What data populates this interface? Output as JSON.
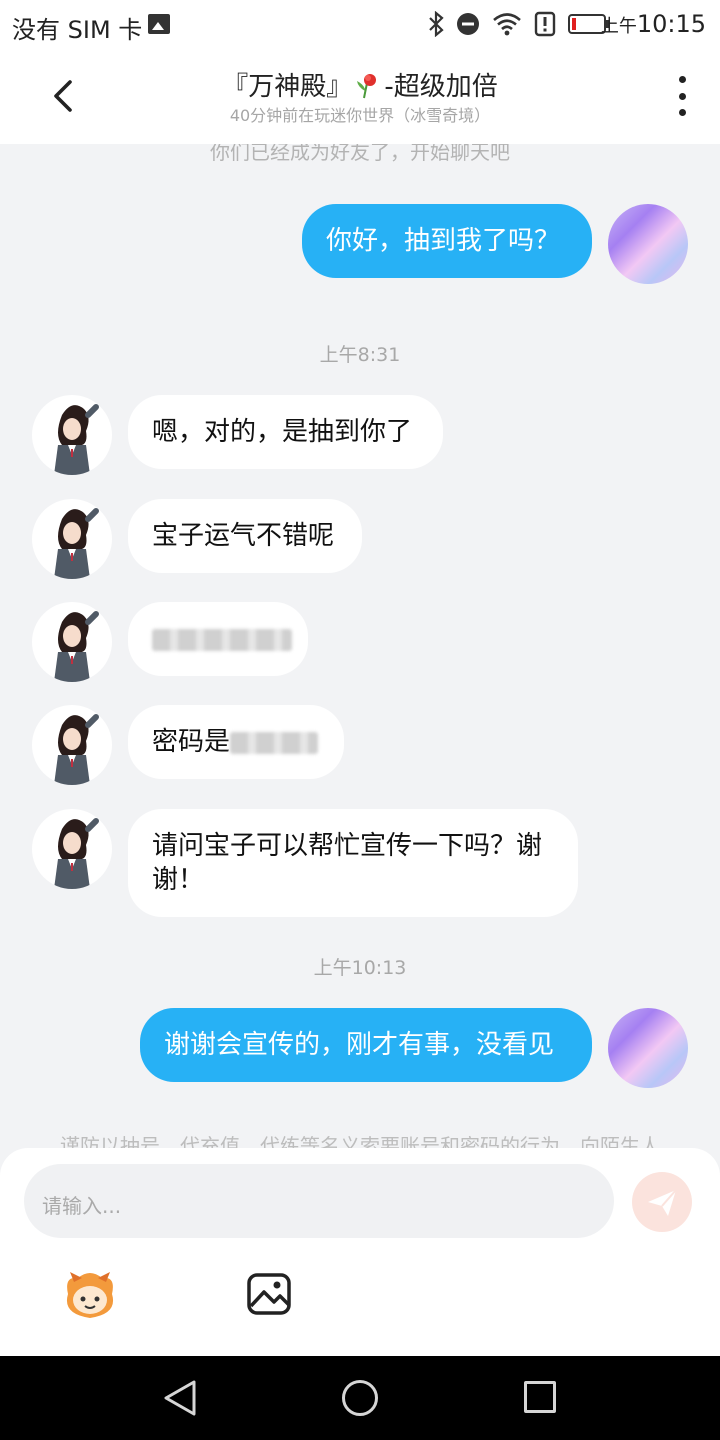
{
  "status_bar": {
    "carrier": "没有 SIM 卡",
    "time_prefix": "上午",
    "time": "10:15"
  },
  "header": {
    "title_left": "『万神殿』",
    "title_right": "-超级加倍",
    "subtitle": "40分钟前在玩迷你世界（冰雪奇境）"
  },
  "chat": {
    "system_notice": "你们已经成为好友了，开始聊天吧",
    "messages": [
      {
        "from": "me",
        "text": "你好，抽到我了吗？"
      },
      {
        "type": "time",
        "text": "上午8:31"
      },
      {
        "from": "other",
        "text": "嗯，对的，是抽到你了"
      },
      {
        "from": "other",
        "text": "宝子运气不错呢"
      },
      {
        "from": "other",
        "text": "",
        "blurred": true
      },
      {
        "from": "other",
        "text": "密码是",
        "blurred_suffix": true
      },
      {
        "from": "other",
        "text_line1": "请问宝子可以帮忙宣传一下吗？谢",
        "text_line2": "谢！"
      },
      {
        "type": "time",
        "text": "上午10:13"
      },
      {
        "from": "me",
        "text": "谢谢会宣传的，刚才有事，没看见"
      }
    ],
    "warning": "谨防以抽号、代充值、代练等名义索要账号和密码的行为，向陌生人"
  },
  "input": {
    "placeholder": "请输入..."
  },
  "colors": {
    "my_bubble": "#27b1f5",
    "background": "#f2f3f5",
    "send_button": "#fbe3dd"
  },
  "icons": [
    "back-arrow-icon",
    "more-dots-icon",
    "emoji-icon",
    "image-icon",
    "send-icon",
    "bluetooth-icon",
    "dnd-icon",
    "wifi-icon",
    "alert-icon",
    "battery-icon"
  ]
}
